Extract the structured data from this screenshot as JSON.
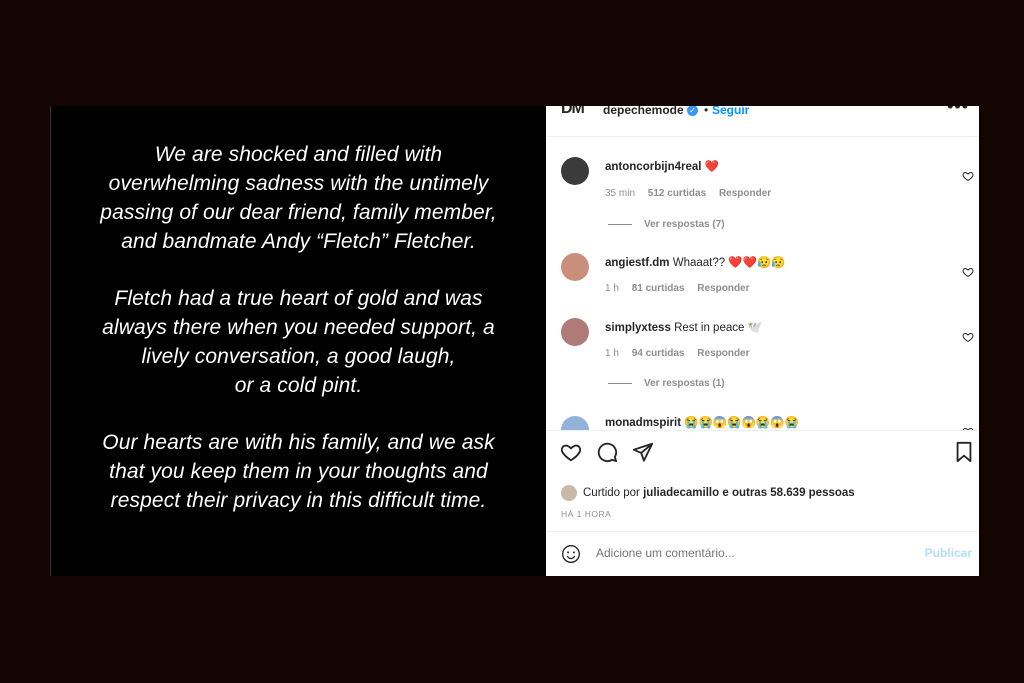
{
  "post_image": {
    "paragraphs": [
      "We are shocked and filled with\noverwhelming sadness with the untimely\npassing of our dear friend, family member,\nand bandmate Andy “Fletch” Fletcher.",
      "Fletch had a true heart of gold and was\nalways there when you needed support, a\nlively conversation, a good laugh,\nor a cold pint.",
      "Our hearts are with his family, and we ask\nthat you keep them in your thoughts and\nrespect their privacy in this difficult time."
    ]
  },
  "header": {
    "logo": "DM",
    "username": "depechemode",
    "separator": "•",
    "follow_label": "Seguir",
    "more": "•••"
  },
  "comments": [
    {
      "user": "antoncorbijn4real",
      "text": "❤️",
      "time": "35 min",
      "likes": "512 curtidas",
      "reply": "Responder",
      "replies": "Ver respostas (7)",
      "avatar_color": "#3b3b3b"
    },
    {
      "user": "angiestf.dm",
      "text": "Whaaat?? ❤️❤️😥😥",
      "time": "1 h",
      "likes": "81 curtidas",
      "reply": "Responder",
      "replies": "",
      "avatar_color": "#c98f7a"
    },
    {
      "user": "simplyxtess",
      "text": "Rest in peace 🕊️",
      "time": "1 h",
      "likes": "94 curtidas",
      "reply": "Responder",
      "replies": "Ver respostas (1)",
      "avatar_color": "#b07a78"
    },
    {
      "user": "monadmspirit",
      "text": "😭😭😱😭😱😭😱😭",
      "time": "",
      "likes": "",
      "reply": "",
      "replies": "",
      "avatar_color": "#8fb3d9"
    }
  ],
  "actions": {
    "liked_prefix": "Curtido por",
    "liked_user": "juliadecamillo",
    "liked_suffix": "e outras 58.639 pessoas",
    "time": "HÁ 1 HORA"
  },
  "add_comment": {
    "placeholder": "Adicione um comentário...",
    "post_label": "Publicar"
  }
}
